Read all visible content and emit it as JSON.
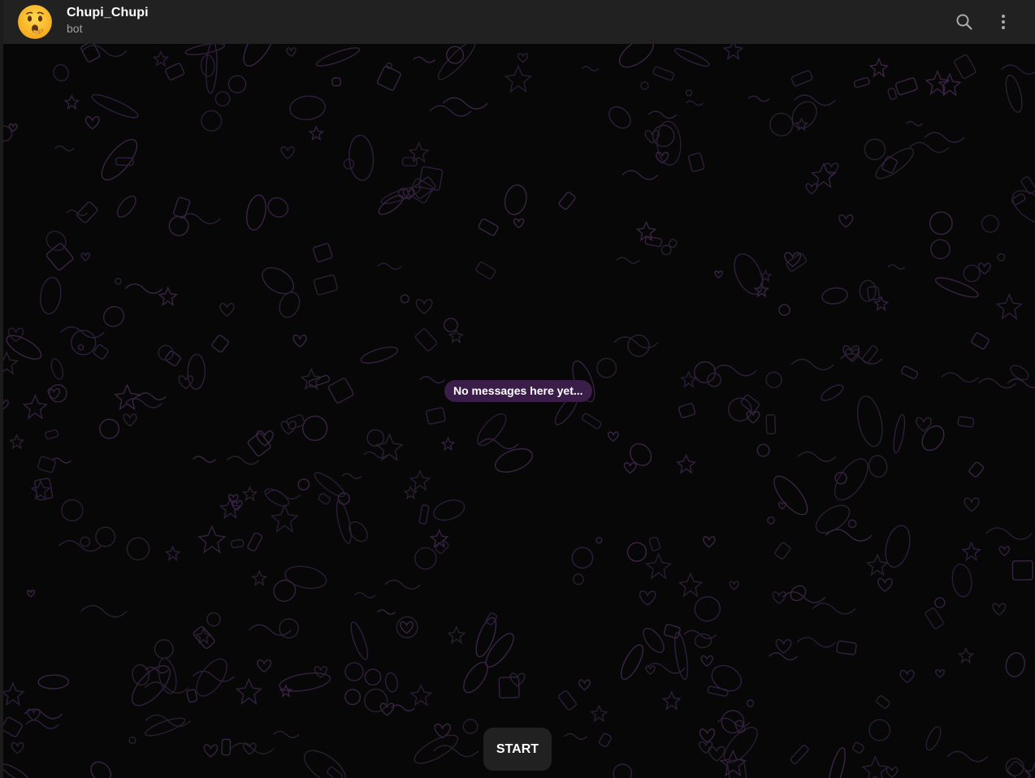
{
  "header": {
    "chat_name": "Chupi_Chupi",
    "chat_status": "bot",
    "avatar_icon": "hushed-face-emoji",
    "search_icon": "search-icon",
    "more_icon": "more-vertical-icon"
  },
  "chat": {
    "empty_message": "No messages here yet...",
    "background_pattern": "doodle-pattern"
  },
  "footer": {
    "start_label": "START"
  },
  "colors": {
    "header_bg": "#212121",
    "chat_bg": "#070707",
    "pill_bg": "#3b1d4a",
    "pattern_stroke": "#3a2444"
  }
}
